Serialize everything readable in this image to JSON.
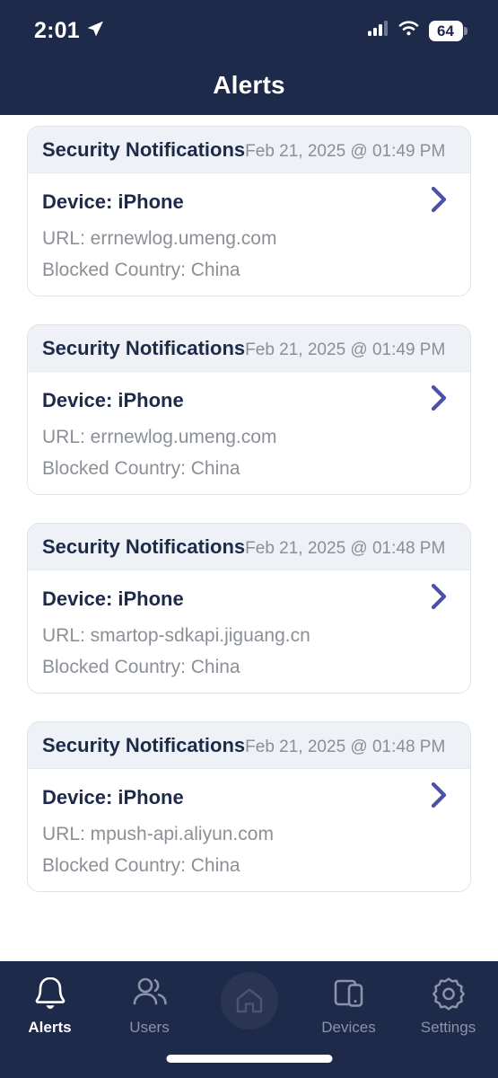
{
  "status_bar": {
    "time": "2:01",
    "location_icon": "location-arrow-icon",
    "cellular_icon": "cellular-signal-icon",
    "wifi_icon": "wifi-icon",
    "battery_level": "64"
  },
  "header": {
    "title": "Alerts"
  },
  "alerts": [
    {
      "title": "Security Notifications",
      "timestamp": "Feb 21, 2025 @ 01:49 PM",
      "device": "Device: iPhone",
      "url": "URL: errnewlog.umeng.com",
      "blocked_country": "Blocked Country: China"
    },
    {
      "title": "Security Notifications",
      "timestamp": "Feb 21, 2025 @ 01:49 PM",
      "device": "Device: iPhone",
      "url": "URL: errnewlog.umeng.com",
      "blocked_country": "Blocked Country: China"
    },
    {
      "title": "Security Notifications",
      "timestamp": "Feb 21, 2025 @ 01:48 PM",
      "device": "Device: iPhone",
      "url": "URL: smartop-sdkapi.jiguang.cn",
      "blocked_country": "Blocked Country: China"
    },
    {
      "title": "Security Notifications",
      "timestamp": "Feb 21, 2025 @ 01:48 PM",
      "device": "Device: iPhone",
      "url": "URL: mpush-api.aliyun.com",
      "blocked_country": "Blocked Country: China"
    }
  ],
  "tabbar": {
    "items": [
      {
        "label": "Alerts",
        "icon": "bell-icon",
        "active": true
      },
      {
        "label": "Users",
        "icon": "users-icon",
        "active": false
      },
      {
        "label": "",
        "icon": "home-icon",
        "active": false
      },
      {
        "label": "Devices",
        "icon": "devices-icon",
        "active": false
      },
      {
        "label": "Settings",
        "icon": "gear-icon",
        "active": false
      }
    ]
  },
  "colors": {
    "navy": "#1e2a4a",
    "accent_chevron": "#4b50a8",
    "card_header_bg": "#eef1f5",
    "muted_text": "#8b9096"
  }
}
